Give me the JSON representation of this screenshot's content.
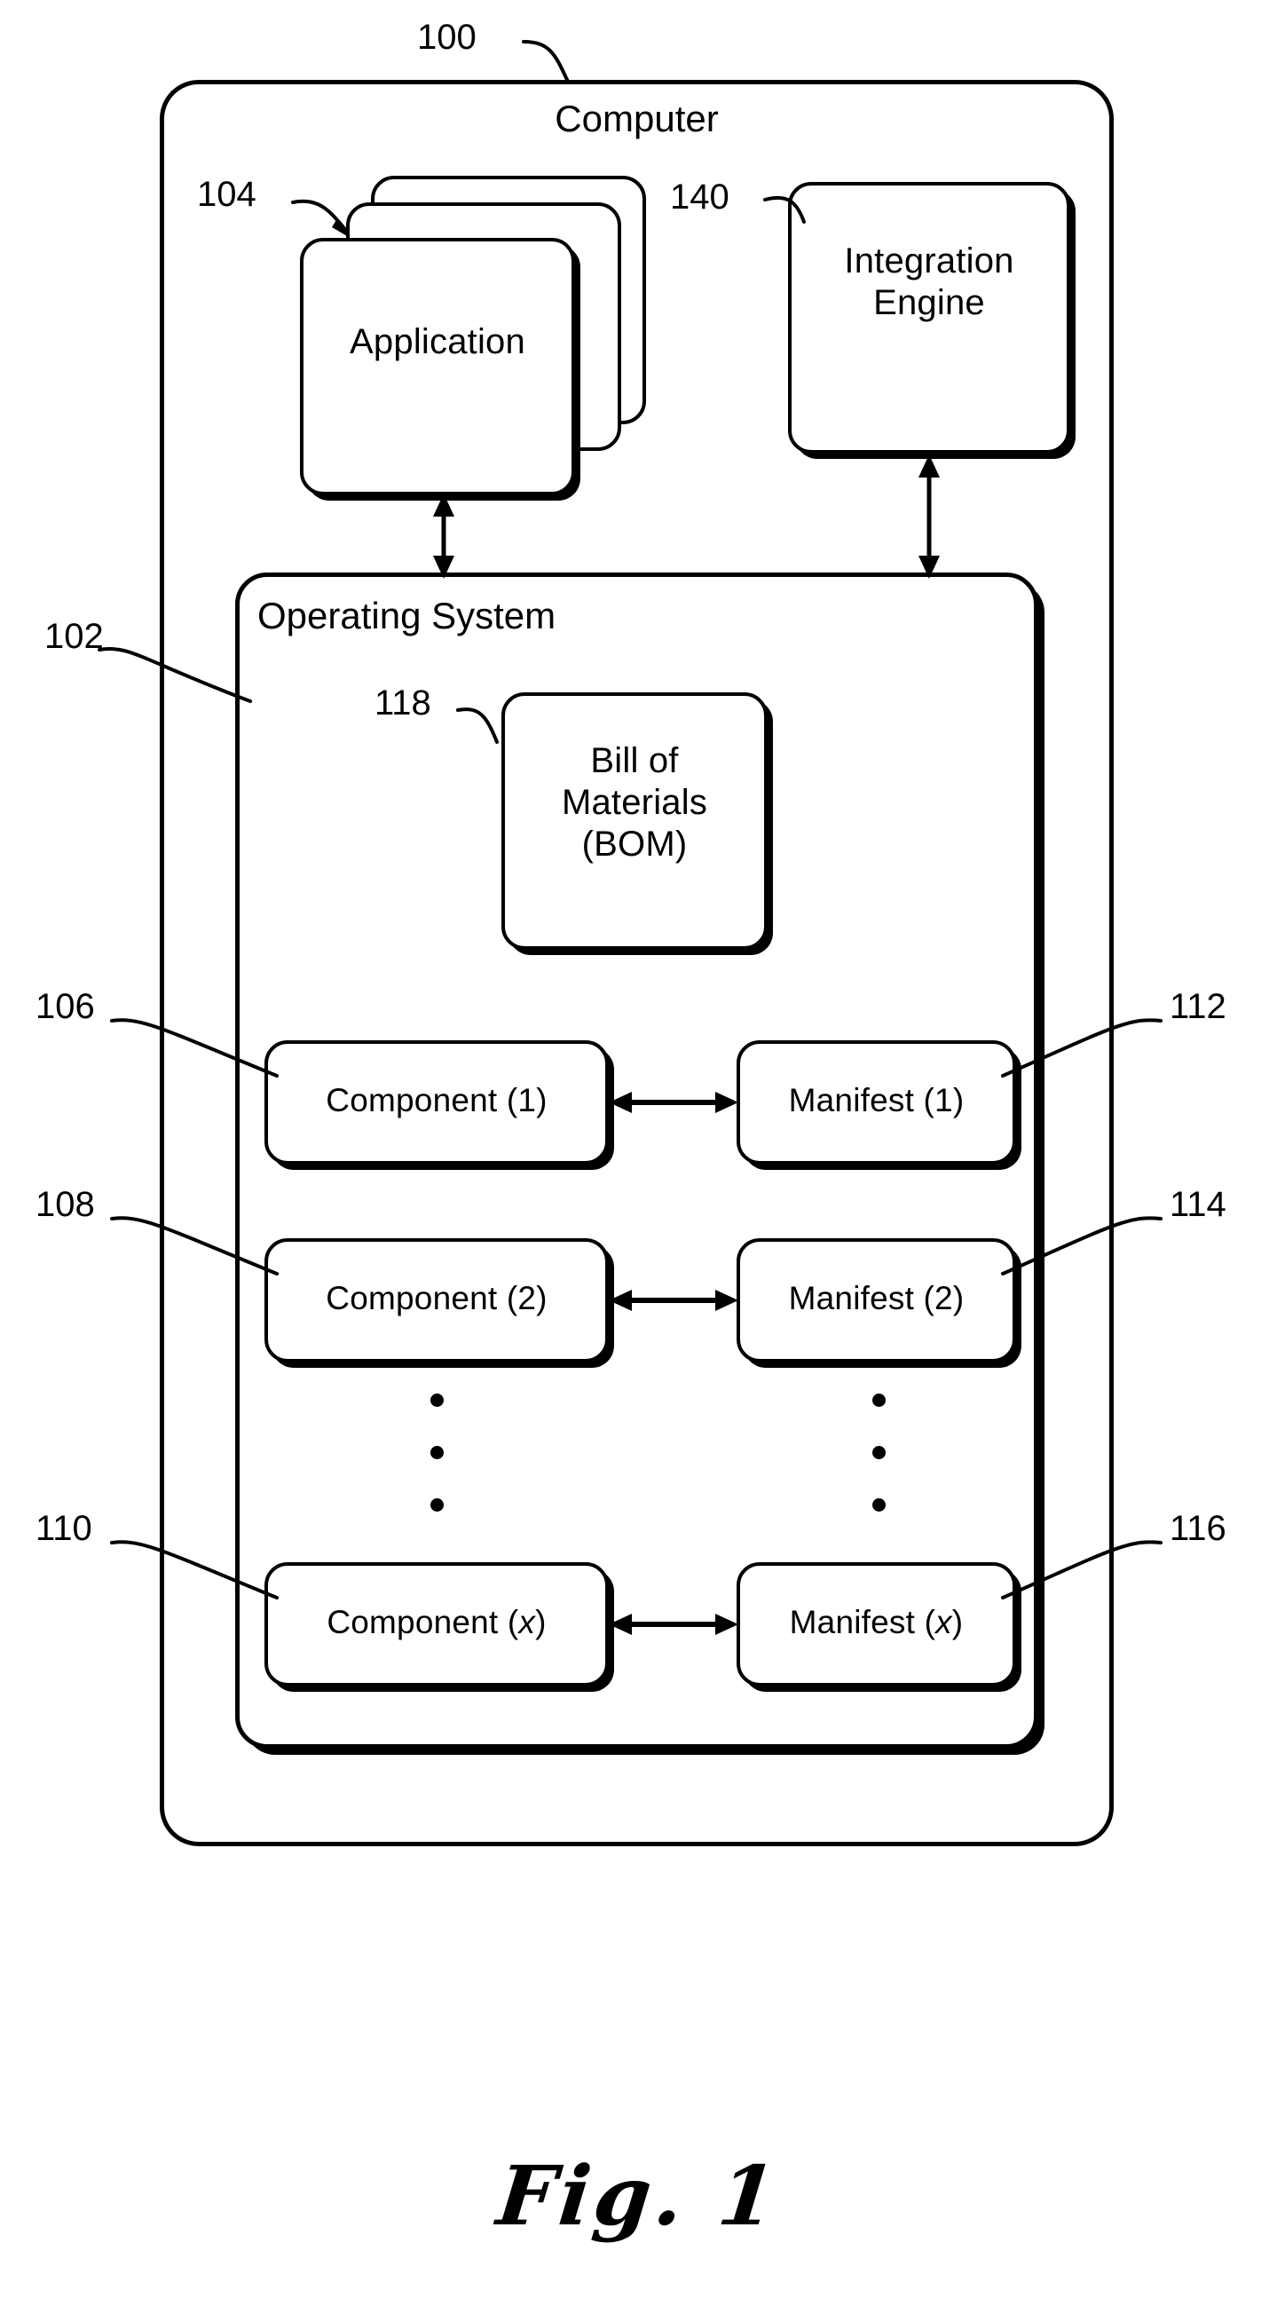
{
  "figure": {
    "caption": "Fig. 1"
  },
  "computer": {
    "title": "Computer",
    "ref": "100"
  },
  "application": {
    "label": "Application",
    "ref": "104",
    "stack_count": 3
  },
  "integration_engine": {
    "label": "Integration\nEngine",
    "ref": "140"
  },
  "operating_system": {
    "title": "Operating System",
    "ref": "102"
  },
  "bom": {
    "label": "Bill of\nMaterials\n(BOM)",
    "ref": "118"
  },
  "rows": [
    {
      "component_label": "Component (1)",
      "component_ref": "106",
      "manifest_label": "Manifest (1)",
      "manifest_ref": "112"
    },
    {
      "component_label": "Component (2)",
      "component_ref": "108",
      "manifest_label": "Manifest (2)",
      "manifest_ref": "114"
    },
    {
      "component_label": "Component (x)",
      "component_ref": "110",
      "manifest_label": "Manifest (x)",
      "manifest_ref": "116"
    }
  ],
  "ellipsis": {
    "dot_count": 3
  },
  "colors": {
    "ink": "#000000",
    "paper": "#ffffff"
  },
  "icons": {
    "double_arrow_vertical": "double-headed-vertical-arrow-icon",
    "double_arrow_horizontal": "double-headed-horizontal-arrow-icon",
    "leader_line": "leader-line-icon",
    "vertical-ellipsis": "vertical-ellipsis-icon"
  }
}
